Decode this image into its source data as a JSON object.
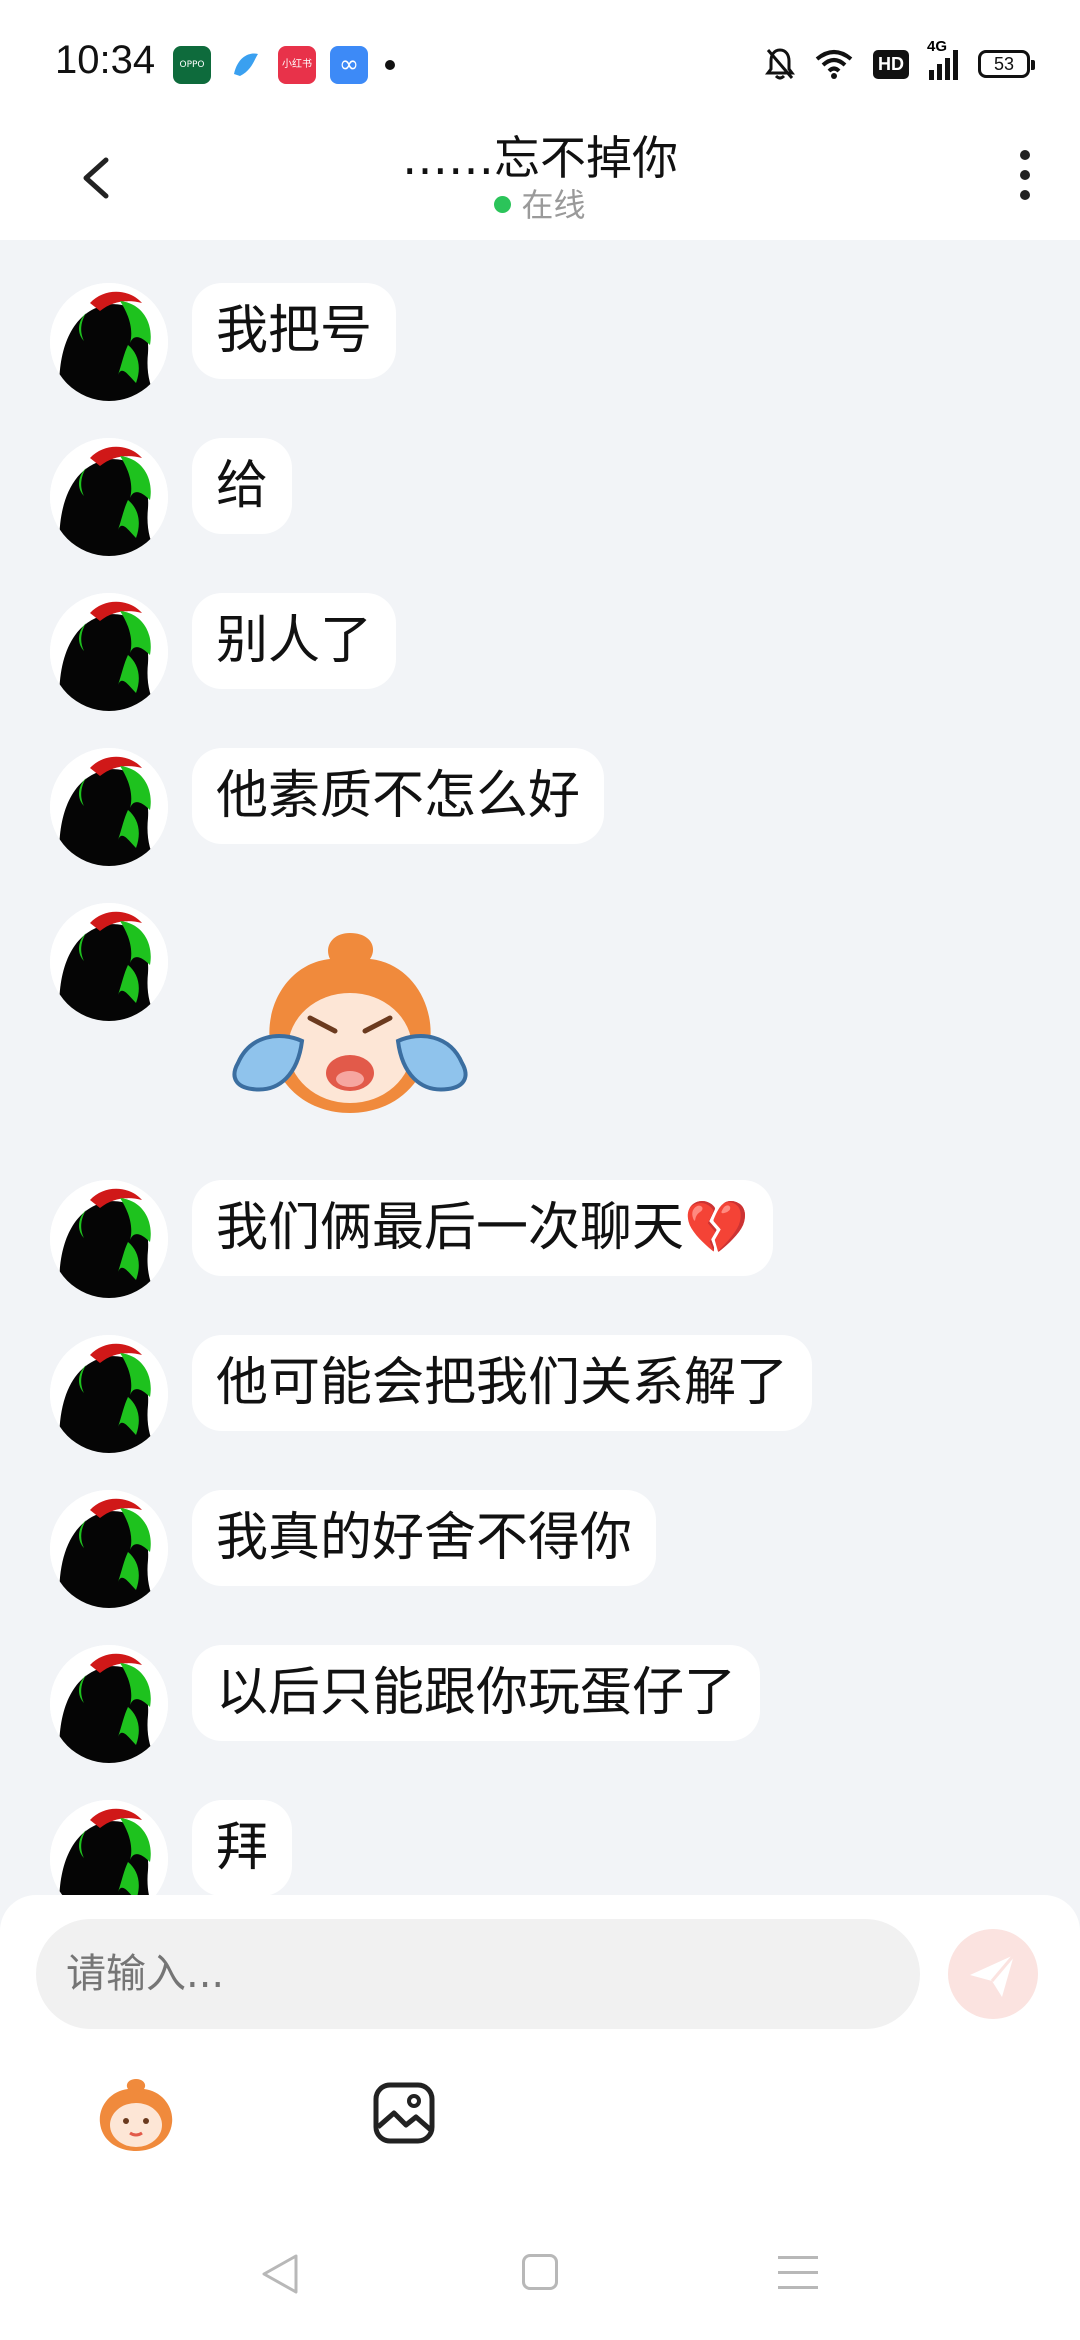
{
  "status_bar": {
    "time": "10:34",
    "network": "4G",
    "battery": "53",
    "hd_label": "HD",
    "app_icons": [
      "oppo-icon",
      "bird-app-icon",
      "xiaohongshu-icon",
      "infinity-app-icon"
    ]
  },
  "header": {
    "title": "……忘不掉你",
    "status": "在线",
    "status_color": "#2bc45a"
  },
  "messages": [
    {
      "type": "text",
      "text": "我把号"
    },
    {
      "type": "text",
      "text": "给"
    },
    {
      "type": "text",
      "text": "别人了"
    },
    {
      "type": "text",
      "text": "他素质不怎么好"
    },
    {
      "type": "sticker",
      "icon": "crying-sticker-icon"
    },
    {
      "type": "text",
      "text": "我们俩最后一次聊天💔"
    },
    {
      "type": "text",
      "text": "他可能会把我们关系解了"
    },
    {
      "type": "text",
      "text": "我真的好舍不得你"
    },
    {
      "type": "text",
      "text": "以后只能跟你玩蛋仔了"
    },
    {
      "type": "text",
      "text": "拜"
    }
  ],
  "composer": {
    "placeholder": "请输入...",
    "send_icon": "send-icon",
    "tools": [
      "emoji-sticker-icon",
      "image-icon"
    ]
  },
  "colors": {
    "background": "#f2f4f7",
    "bubble": "#ffffff",
    "send_button": "#fbe3e0"
  }
}
